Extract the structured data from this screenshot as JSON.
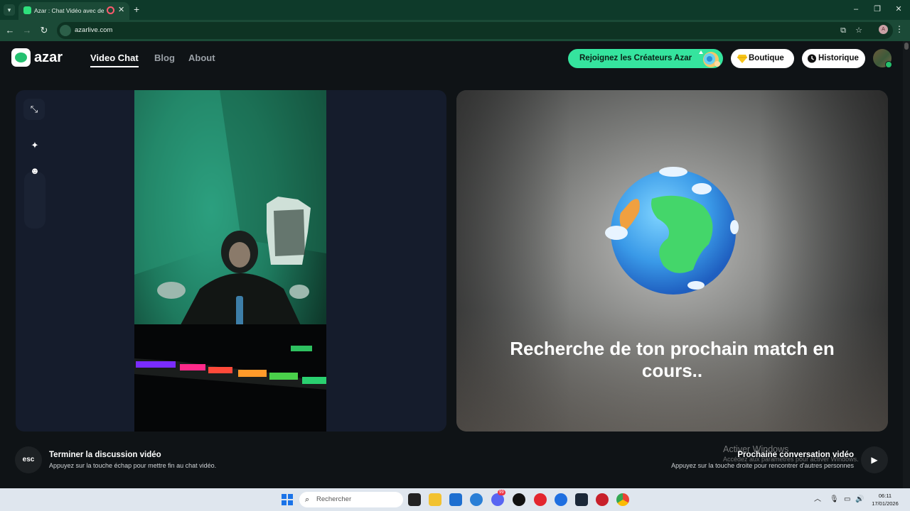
{
  "browser": {
    "tab_title": "Azar : Chat Vidéo avec de n",
    "tab_close": "✕",
    "new_tab": "+",
    "url": "azarlive.com",
    "profile_initial": "A"
  },
  "header": {
    "logo_text": "azar",
    "nav": [
      {
        "label": "Video Chat",
        "active": true
      },
      {
        "label": "Blog",
        "active": false
      },
      {
        "label": "About",
        "active": false
      }
    ],
    "creators_label": "Rejoignez les Créateurs Azar",
    "shop_label": "Boutique",
    "history_label": "Historique"
  },
  "match": {
    "searching_text": "Recherche de ton prochain match en cours.."
  },
  "footer": {
    "esc_key": "esc",
    "end_title": "Terminer la discussion vidéo",
    "end_sub": "Appuyez sur la touche échap pour mettre fin au chat vidéo.",
    "next_title": "Prochaine conversation vidéo",
    "next_sub": "Appuyez sur la touche droite pour rencontrer d'autres personnes",
    "activate_title": "Activer Windows",
    "activate_sub": "Accédez aux paramètres pour activer Windows."
  },
  "taskbar": {
    "search_placeholder": "Rechercher",
    "time": "06:11",
    "date": "17/01/2026",
    "discord_badge": "99"
  },
  "colors": {
    "accent_green": "#35e49e",
    "browser_frame": "#0e3a2a",
    "page_bg": "#0f1316"
  }
}
